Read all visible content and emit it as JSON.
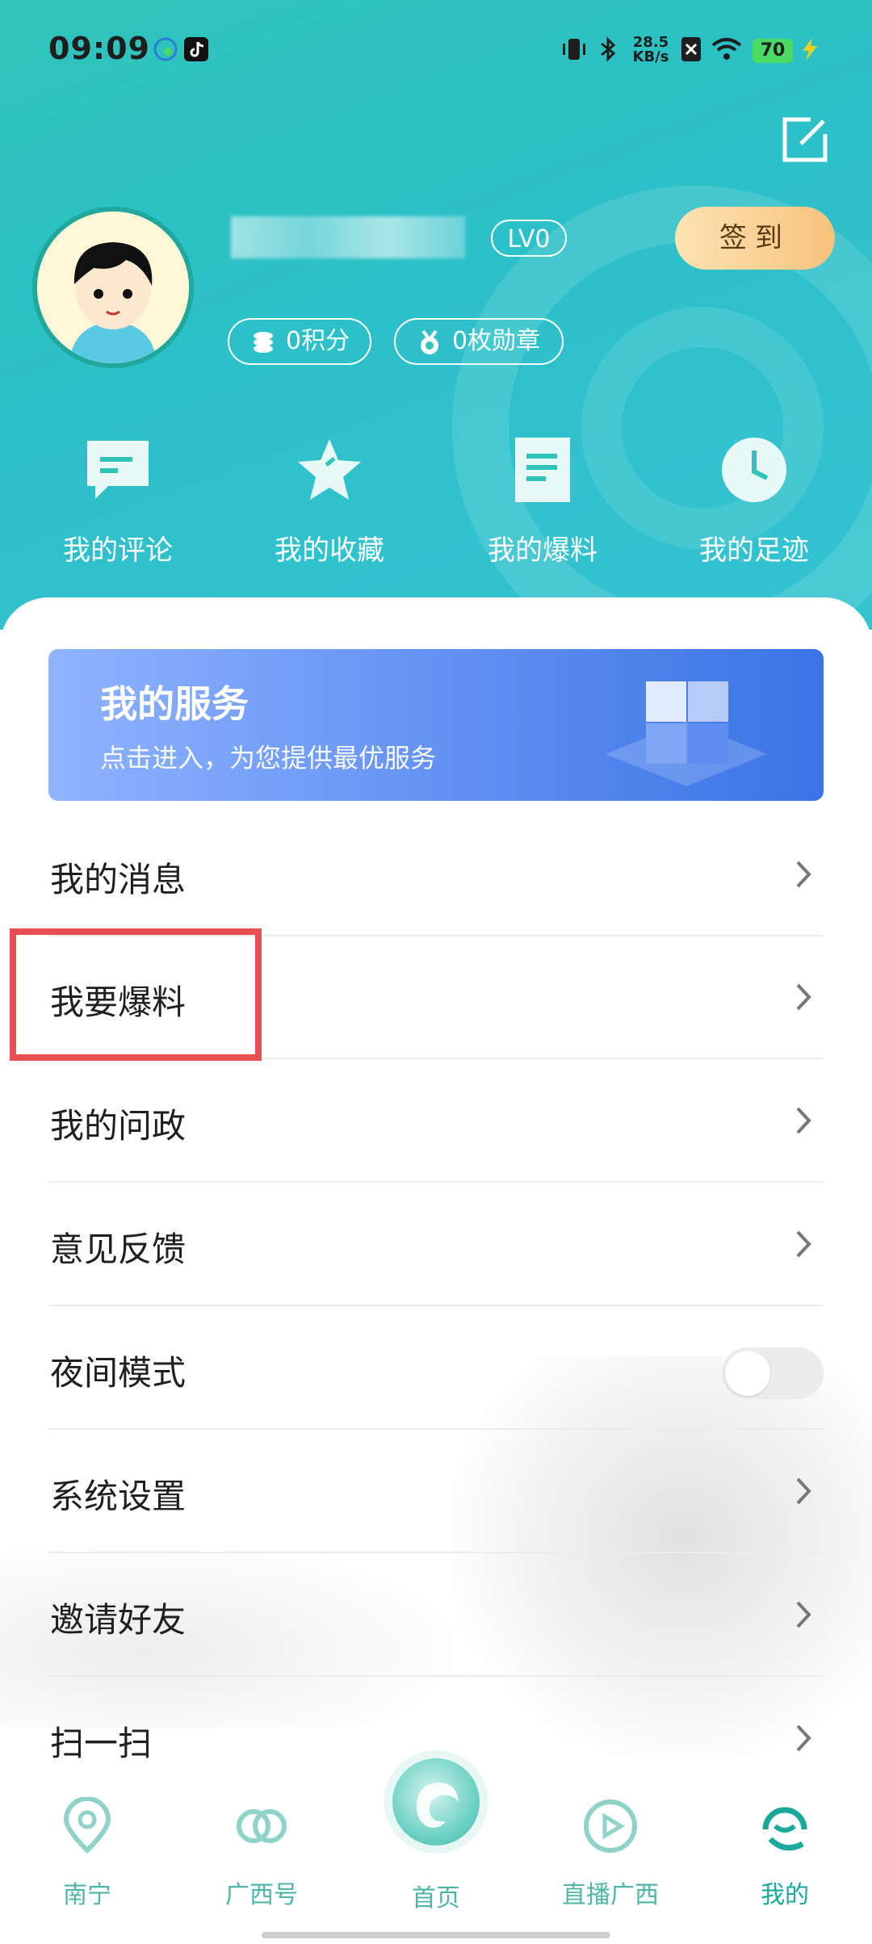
{
  "status_bar": {
    "time": "09:09",
    "network_speed": "28.5 KB/s",
    "battery": "70"
  },
  "profile": {
    "level": "LV0",
    "checkin_label": "签到",
    "points": "0积分",
    "badges": "0枚勋章"
  },
  "quick_actions": [
    {
      "label": "我的评论",
      "icon": "comment-icon"
    },
    {
      "label": "我的收藏",
      "icon": "star-icon"
    },
    {
      "label": "我的爆料",
      "icon": "document-icon"
    },
    {
      "label": "我的足迹",
      "icon": "clock-icon"
    }
  ],
  "service_banner": {
    "title": "我的服务",
    "subtitle": "点击进入，为您提供最优服务"
  },
  "menu": [
    {
      "label": "我的消息"
    },
    {
      "label": "我要爆料"
    },
    {
      "label": "我的问政"
    },
    {
      "label": "意见反馈"
    },
    {
      "label": "夜间模式",
      "toggle": false
    },
    {
      "label": "系统设置"
    },
    {
      "label": "邀请好友"
    },
    {
      "label": "扫一扫"
    }
  ],
  "tabs": [
    {
      "label": "南宁",
      "icon": "location-icon"
    },
    {
      "label": "广西号",
      "icon": "link-icon"
    },
    {
      "label": "首页",
      "icon": "home-logo-icon"
    },
    {
      "label": "直播广西",
      "icon": "play-icon"
    },
    {
      "label": "我的",
      "icon": "profile-icon"
    }
  ],
  "colors": {
    "teal": "#2ec4b9",
    "banner_blue": "#5f8ff2",
    "highlight_red": "#e8504f"
  }
}
